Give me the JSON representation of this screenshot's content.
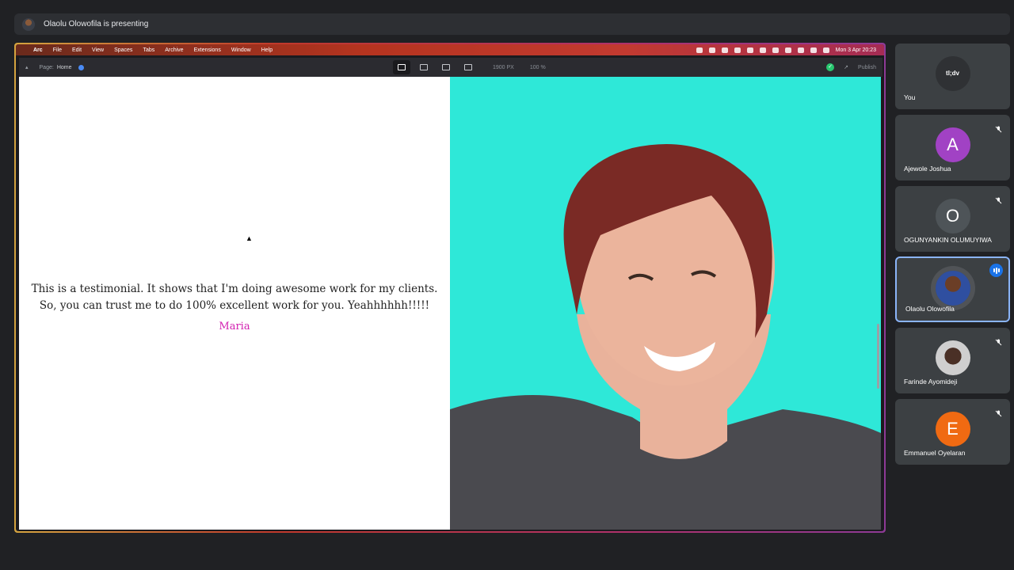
{
  "banner": {
    "text": "Olaolu Olowofila is presenting"
  },
  "menubar": {
    "items": [
      "Arc",
      "File",
      "Edit",
      "View",
      "Spaces",
      "Tabs",
      "Archive",
      "Extensions",
      "Window",
      "Help"
    ],
    "clock": "Mon 3 Apr  20:23"
  },
  "toolbar": {
    "page_label": "Page:",
    "page_value": "Home",
    "width_value": "1900 PX",
    "zoom_value": "100 %",
    "publish_label": "Publish"
  },
  "site": {
    "quote_line1": "This is a testimonial. It shows that I'm doing awesome work for my clients.",
    "quote_line2": "So, you can trust me to do 100% excellent work for you. Yeahhhhhh!!!!!",
    "author": "Maria"
  },
  "participants": [
    {
      "name": "You",
      "avatar": "tl;dv",
      "muted": false
    },
    {
      "name": "Ajewole Joshua",
      "initial": "A",
      "color": "#a142c4",
      "muted": true
    },
    {
      "name": "OGUNYANKIN OLUMUYIWA",
      "initial": "O",
      "color": "#4e5458",
      "muted": true
    },
    {
      "name": "Olaolu Olowofila",
      "speaking": true
    },
    {
      "name": "Farinde Ayomideji",
      "muted": true
    },
    {
      "name": "Emmanuel Oyelaran",
      "initial": "E",
      "color": "#f06a12",
      "muted": true
    }
  ]
}
